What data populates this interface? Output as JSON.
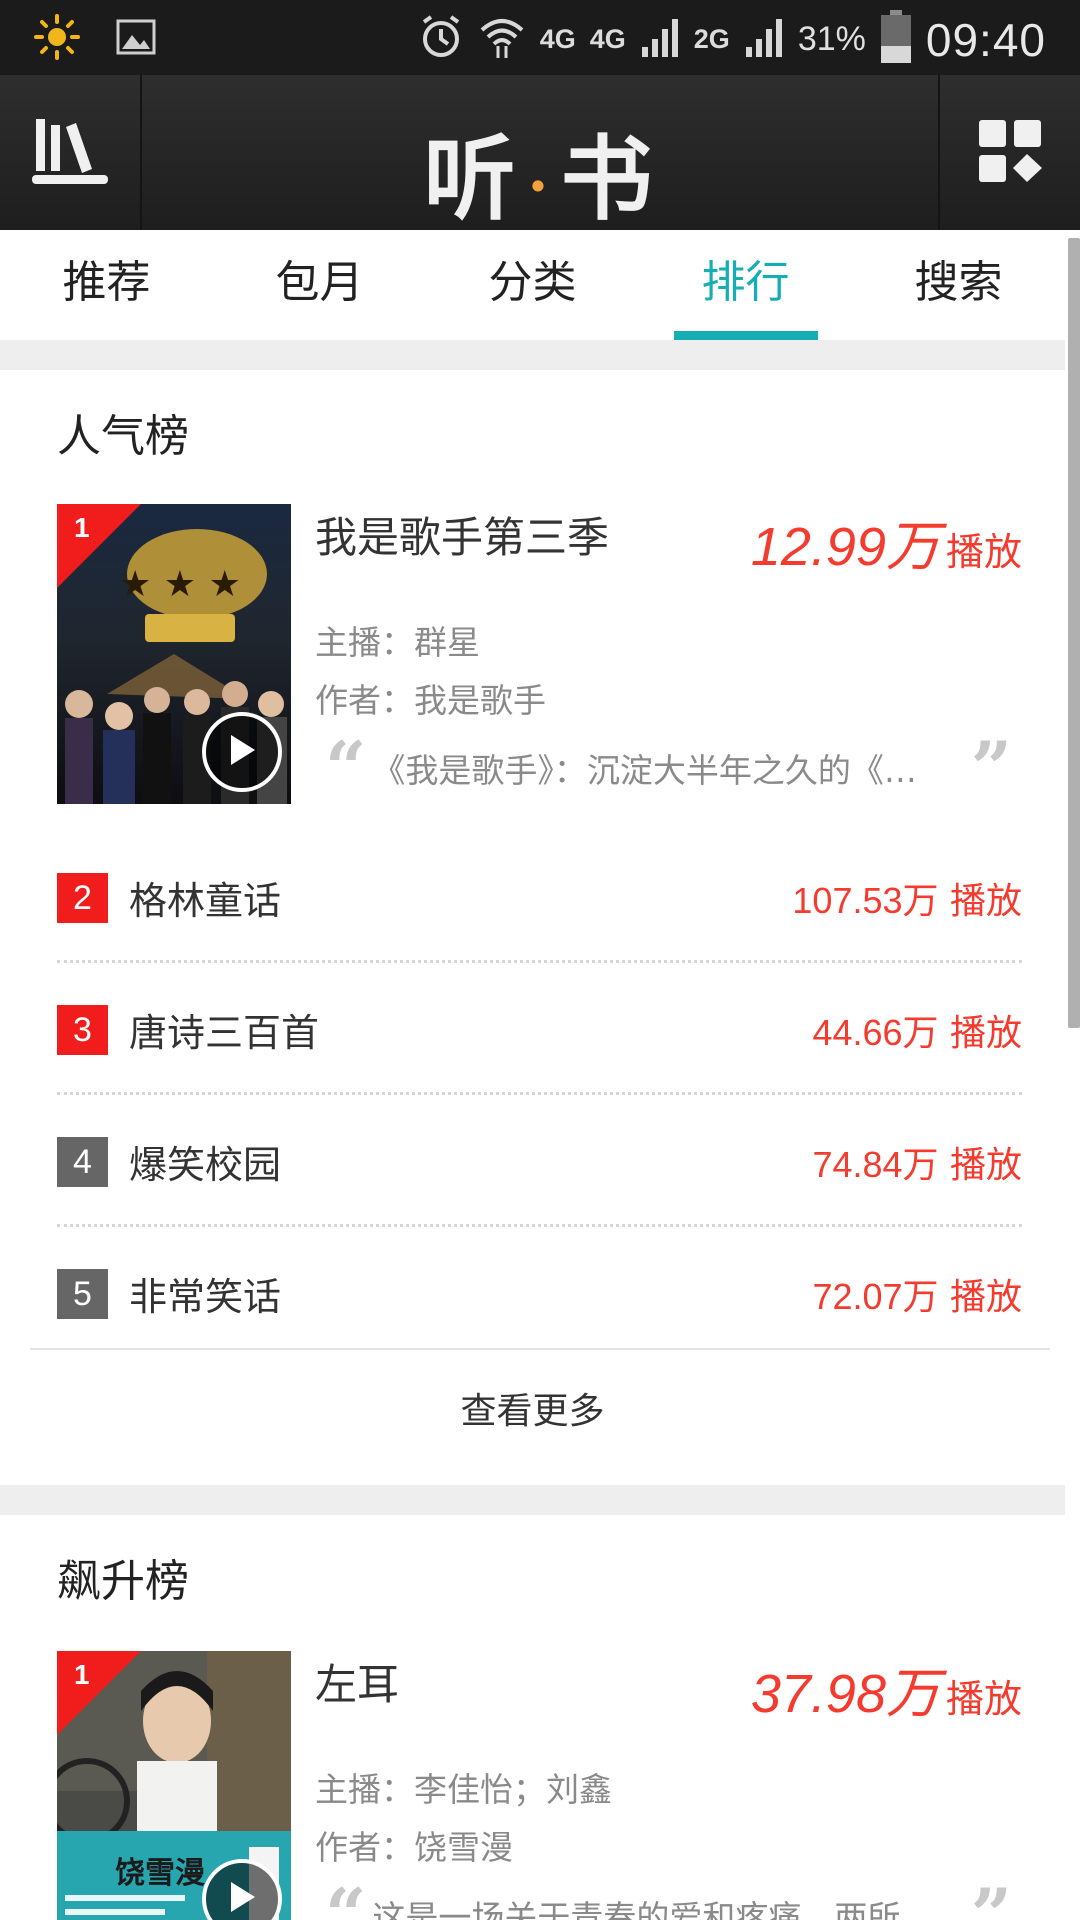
{
  "status_bar": {
    "icons": [
      "sun-icon",
      "image-icon",
      "alarm-icon",
      "wifi-icon",
      "signal-icon",
      "battery-icon"
    ],
    "net1": "4G",
    "net2": "4G",
    "net3": "2G",
    "battery": "31%",
    "time": "09:40"
  },
  "header": {
    "title_left": "听",
    "title_dot": "·",
    "title_right": "书"
  },
  "tabs": [
    {
      "label": "推荐"
    },
    {
      "label": "包月"
    },
    {
      "label": "分类"
    },
    {
      "label": "排行"
    },
    {
      "label": "搜索"
    }
  ],
  "active_tab": "排行",
  "colors": {
    "accent": "#14aeb4",
    "rank_red": "#f11d1d",
    "rank_gray": "#666666",
    "plays_red": "#f43b2e"
  },
  "popular": {
    "title": "人气榜",
    "top": {
      "rank": "1",
      "title": "我是歌手第三季",
      "plays": "12.99万",
      "plays_label": "播放",
      "host": "主播：群星",
      "author": "作者：我是歌手",
      "quote_open": "“",
      "quote": "《我是歌手》：沉淀大半年之久的《…",
      "quote_close": "”"
    },
    "items": [
      {
        "rank": "2",
        "name": "格林童话",
        "plays": "107.53万",
        "plays_label": "播放"
      },
      {
        "rank": "3",
        "name": "唐诗三百首",
        "plays": "44.66万",
        "plays_label": "播放"
      },
      {
        "rank": "4",
        "name": "爆笑校园",
        "plays": "74.84万",
        "plays_label": "播放"
      },
      {
        "rank": "5",
        "name": "非常笑话",
        "plays": "72.07万",
        "plays_label": "播放"
      }
    ],
    "more": "查看更多"
  },
  "rising": {
    "title": "飙升榜",
    "top": {
      "rank": "1",
      "title": "左耳",
      "plays": "37.98万",
      "plays_label": "播放",
      "host": "主播：李佳怡；刘鑫",
      "author": "作者：饶雪漫",
      "quote_open": "“",
      "quote": "这是一场关于青春的爱和疼痛。两所…",
      "quote_close": "”"
    }
  }
}
